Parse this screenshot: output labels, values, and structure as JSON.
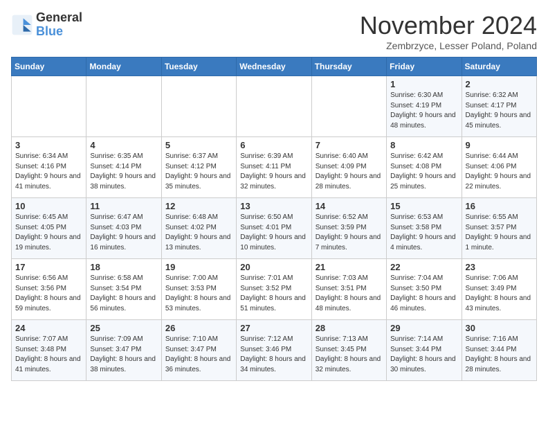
{
  "logo": {
    "line1": "General",
    "line2": "Blue"
  },
  "title": "November 2024",
  "subtitle": "Zembrzyce, Lesser Poland, Poland",
  "days_of_week": [
    "Sunday",
    "Monday",
    "Tuesday",
    "Wednesday",
    "Thursday",
    "Friday",
    "Saturday"
  ],
  "weeks": [
    [
      {
        "day": "",
        "info": ""
      },
      {
        "day": "",
        "info": ""
      },
      {
        "day": "",
        "info": ""
      },
      {
        "day": "",
        "info": ""
      },
      {
        "day": "",
        "info": ""
      },
      {
        "day": "1",
        "info": "Sunrise: 6:30 AM\nSunset: 4:19 PM\nDaylight: 9 hours and 48 minutes."
      },
      {
        "day": "2",
        "info": "Sunrise: 6:32 AM\nSunset: 4:17 PM\nDaylight: 9 hours and 45 minutes."
      }
    ],
    [
      {
        "day": "3",
        "info": "Sunrise: 6:34 AM\nSunset: 4:16 PM\nDaylight: 9 hours and 41 minutes."
      },
      {
        "day": "4",
        "info": "Sunrise: 6:35 AM\nSunset: 4:14 PM\nDaylight: 9 hours and 38 minutes."
      },
      {
        "day": "5",
        "info": "Sunrise: 6:37 AM\nSunset: 4:12 PM\nDaylight: 9 hours and 35 minutes."
      },
      {
        "day": "6",
        "info": "Sunrise: 6:39 AM\nSunset: 4:11 PM\nDaylight: 9 hours and 32 minutes."
      },
      {
        "day": "7",
        "info": "Sunrise: 6:40 AM\nSunset: 4:09 PM\nDaylight: 9 hours and 28 minutes."
      },
      {
        "day": "8",
        "info": "Sunrise: 6:42 AM\nSunset: 4:08 PM\nDaylight: 9 hours and 25 minutes."
      },
      {
        "day": "9",
        "info": "Sunrise: 6:44 AM\nSunset: 4:06 PM\nDaylight: 9 hours and 22 minutes."
      }
    ],
    [
      {
        "day": "10",
        "info": "Sunrise: 6:45 AM\nSunset: 4:05 PM\nDaylight: 9 hours and 19 minutes."
      },
      {
        "day": "11",
        "info": "Sunrise: 6:47 AM\nSunset: 4:03 PM\nDaylight: 9 hours and 16 minutes."
      },
      {
        "day": "12",
        "info": "Sunrise: 6:48 AM\nSunset: 4:02 PM\nDaylight: 9 hours and 13 minutes."
      },
      {
        "day": "13",
        "info": "Sunrise: 6:50 AM\nSunset: 4:01 PM\nDaylight: 9 hours and 10 minutes."
      },
      {
        "day": "14",
        "info": "Sunrise: 6:52 AM\nSunset: 3:59 PM\nDaylight: 9 hours and 7 minutes."
      },
      {
        "day": "15",
        "info": "Sunrise: 6:53 AM\nSunset: 3:58 PM\nDaylight: 9 hours and 4 minutes."
      },
      {
        "day": "16",
        "info": "Sunrise: 6:55 AM\nSunset: 3:57 PM\nDaylight: 9 hours and 1 minute."
      }
    ],
    [
      {
        "day": "17",
        "info": "Sunrise: 6:56 AM\nSunset: 3:56 PM\nDaylight: 8 hours and 59 minutes."
      },
      {
        "day": "18",
        "info": "Sunrise: 6:58 AM\nSunset: 3:54 PM\nDaylight: 8 hours and 56 minutes."
      },
      {
        "day": "19",
        "info": "Sunrise: 7:00 AM\nSunset: 3:53 PM\nDaylight: 8 hours and 53 minutes."
      },
      {
        "day": "20",
        "info": "Sunrise: 7:01 AM\nSunset: 3:52 PM\nDaylight: 8 hours and 51 minutes."
      },
      {
        "day": "21",
        "info": "Sunrise: 7:03 AM\nSunset: 3:51 PM\nDaylight: 8 hours and 48 minutes."
      },
      {
        "day": "22",
        "info": "Sunrise: 7:04 AM\nSunset: 3:50 PM\nDaylight: 8 hours and 46 minutes."
      },
      {
        "day": "23",
        "info": "Sunrise: 7:06 AM\nSunset: 3:49 PM\nDaylight: 8 hours and 43 minutes."
      }
    ],
    [
      {
        "day": "24",
        "info": "Sunrise: 7:07 AM\nSunset: 3:48 PM\nDaylight: 8 hours and 41 minutes."
      },
      {
        "day": "25",
        "info": "Sunrise: 7:09 AM\nSunset: 3:47 PM\nDaylight: 8 hours and 38 minutes."
      },
      {
        "day": "26",
        "info": "Sunrise: 7:10 AM\nSunset: 3:47 PM\nDaylight: 8 hours and 36 minutes."
      },
      {
        "day": "27",
        "info": "Sunrise: 7:12 AM\nSunset: 3:46 PM\nDaylight: 8 hours and 34 minutes."
      },
      {
        "day": "28",
        "info": "Sunrise: 7:13 AM\nSunset: 3:45 PM\nDaylight: 8 hours and 32 minutes."
      },
      {
        "day": "29",
        "info": "Sunrise: 7:14 AM\nSunset: 3:44 PM\nDaylight: 8 hours and 30 minutes."
      },
      {
        "day": "30",
        "info": "Sunrise: 7:16 AM\nSunset: 3:44 PM\nDaylight: 8 hours and 28 minutes."
      }
    ]
  ]
}
